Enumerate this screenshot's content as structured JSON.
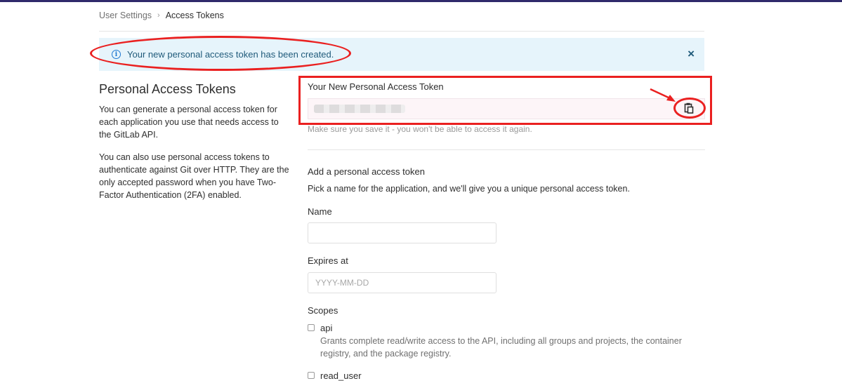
{
  "breadcrumb": {
    "parent": "User Settings",
    "separator": "›",
    "current": "Access Tokens"
  },
  "flash": {
    "icon": "info-icon",
    "message": "Your new personal access token has been created.",
    "close": "×"
  },
  "sidebar": {
    "title": "Personal Access Tokens",
    "paragraph1": "You can generate a personal access token for each application you use that needs access to the GitLab API.",
    "paragraph2": "You can also use personal access tokens to authenticate against Git over HTTP. They are the only accepted password when you have Two-Factor Authentication (2FA) enabled."
  },
  "new_token": {
    "label": "Your New Personal Access Token",
    "help": "Make sure you save it - you won't be able to access it again.",
    "copy_icon": "clipboard-icon"
  },
  "form": {
    "title": "Add a personal access token",
    "description": "Pick a name for the application, and we'll give you a unique personal access token.",
    "name_label": "Name",
    "name_value": "",
    "expires_label": "Expires at",
    "expires_placeholder": "YYYY-MM-DD",
    "scopes_label": "Scopes",
    "scopes": [
      {
        "name": "api",
        "description": "Grants complete read/write access to the API, including all groups and projects, the container registry, and the package registry."
      },
      {
        "name": "read_user",
        "description": ""
      }
    ]
  },
  "colors": {
    "annotation": "#ea2020",
    "flash_bg": "#e6f4fb",
    "info_blue": "#1f78d1"
  }
}
